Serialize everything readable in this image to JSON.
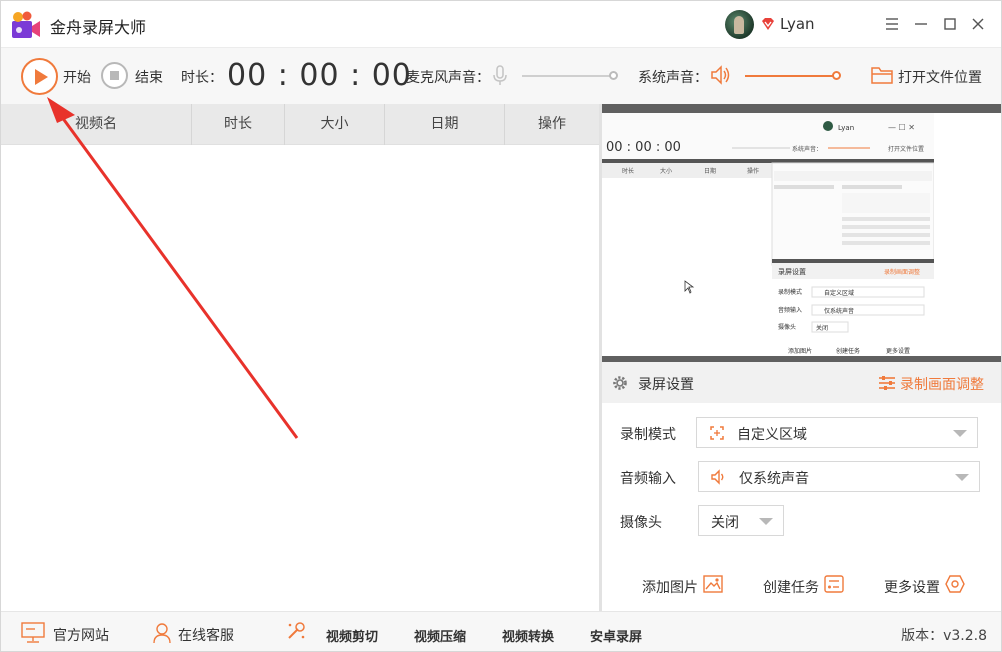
{
  "app": {
    "title": "金舟录屏大师",
    "username": "Lyan",
    "accent": "#f07a3c"
  },
  "window_controls": [
    "menu-icon",
    "minimize-icon",
    "maximize-icon",
    "close-icon"
  ],
  "toolbar": {
    "start_label": "开始",
    "stop_label": "结束",
    "duration_label": "时长：",
    "timer": "00 : 00 : 00",
    "mic_label": "麦克风声音：",
    "mic_level": 0,
    "system_label": "系统声音：",
    "system_level": 1.0,
    "open_folder_label": "打开文件位置"
  },
  "table": {
    "columns": [
      "视频名",
      "时长",
      "大小",
      "日期",
      "操作"
    ],
    "rows": []
  },
  "preview": {
    "timer": "00 : 00 : 00",
    "username": "Lyan",
    "system_label": "系统声音：",
    "open_folder_label": "打开文件位置",
    "columns": [
      "时长",
      "大小",
      "日期",
      "操作"
    ],
    "settings_title": "录屏设置",
    "settings_adjust": "录制画面调整",
    "mode_label": "录制模式",
    "mode_value": "自定义区域",
    "audio_label": "音频输入",
    "audio_value": "仅系统声音",
    "camera_label": "摄像头",
    "camera_value": "关闭",
    "actions": [
      "添加图片",
      "创建任务",
      "更多设置"
    ]
  },
  "settings": {
    "title": "录屏设置",
    "adjust_label": "录制画面调整",
    "mode_label": "录制模式",
    "mode_value": "自定义区域",
    "audio_label": "音频输入",
    "audio_value": "仅系统声音",
    "camera_label": "摄像头",
    "camera_value": "关闭",
    "add_image": "添加图片",
    "create_task": "创建任务",
    "more_settings": "更多设置"
  },
  "statusbar": {
    "website": "官方网站",
    "support": "在线客服",
    "video_cut": "视频剪切",
    "video_compress": "视频压缩",
    "video_convert": "视频转换",
    "android_record": "安卓录屏",
    "version": "版本：v3.2.8"
  }
}
